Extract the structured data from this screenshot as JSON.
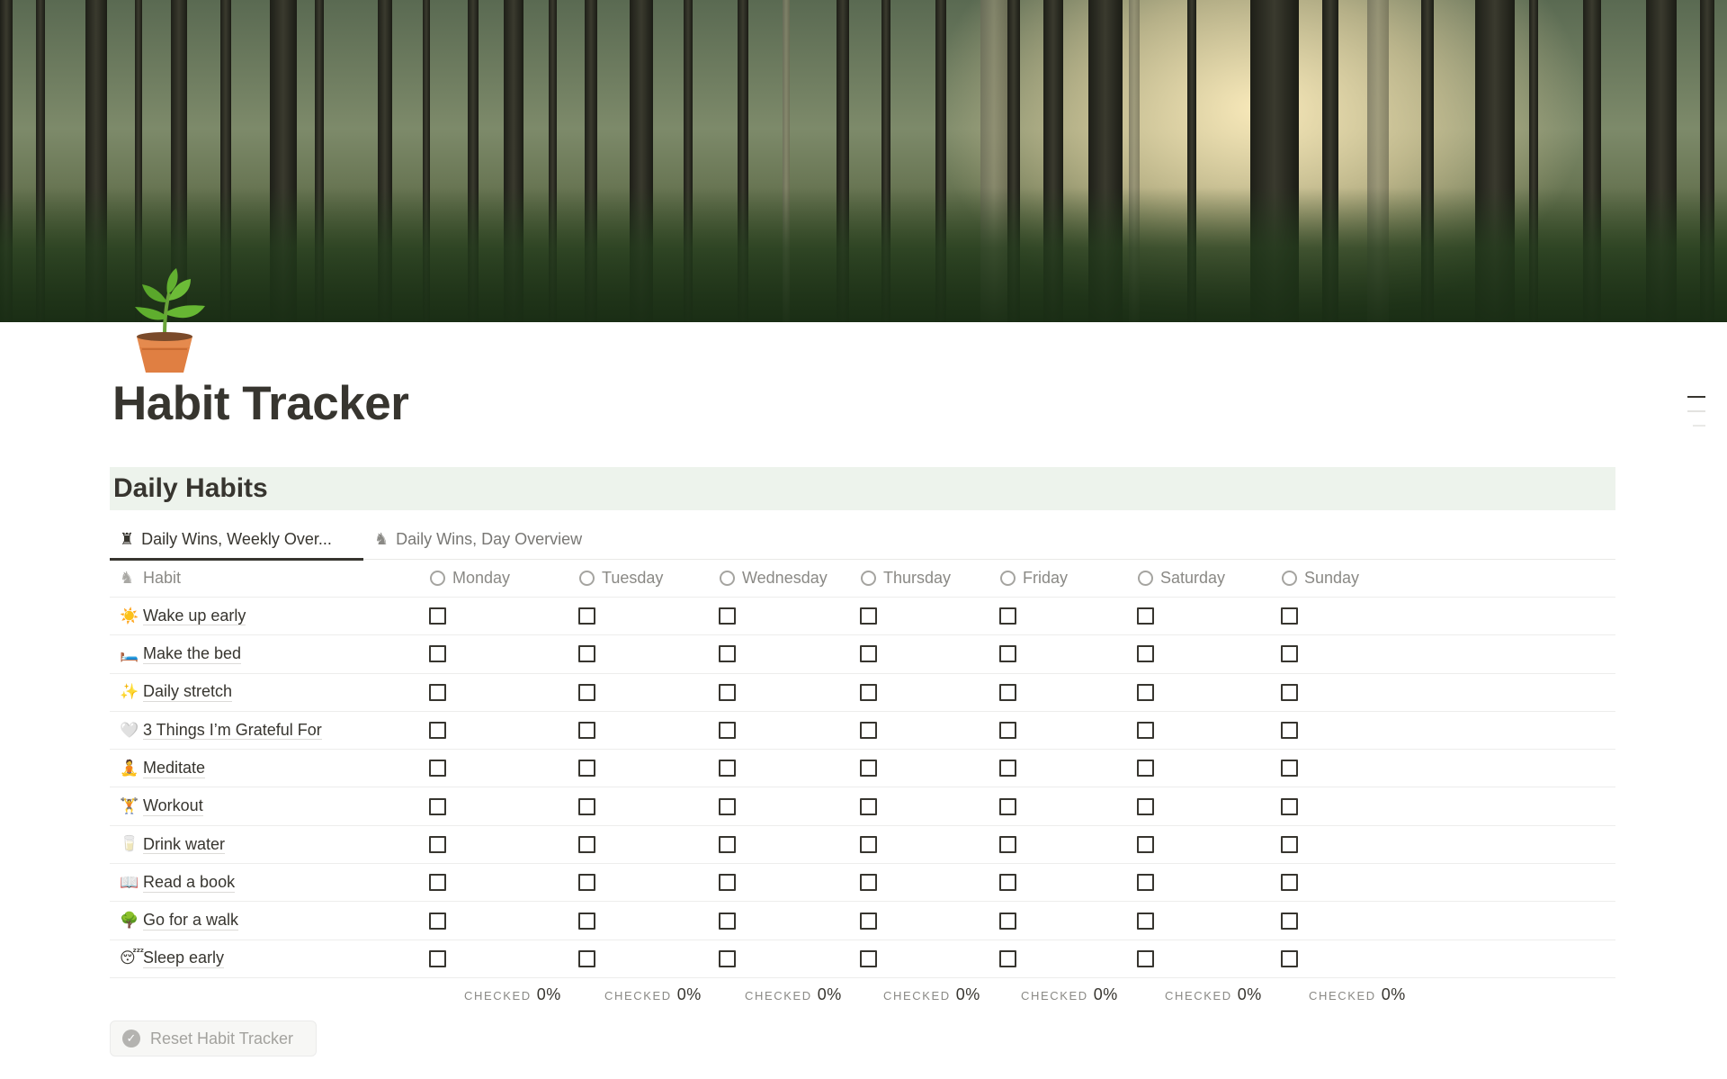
{
  "page": {
    "title": "Habit Tracker",
    "icon": "potted-plant"
  },
  "section": {
    "heading": "Daily Habits",
    "heading_bg": "#edf3ec"
  },
  "tabs": [
    {
      "label": "Daily Wins, Weekly Over...",
      "icon": "chess-rook-icon",
      "glyph": "♜",
      "active": true
    },
    {
      "label": "Daily Wins, Day Overview",
      "icon": "chess-knight-icon",
      "glyph": "♞",
      "active": false
    }
  ],
  "table": {
    "habit_header": {
      "label": "Habit",
      "icon": "chess-knight-icon",
      "glyph": "♞"
    },
    "days": [
      "Monday",
      "Tuesday",
      "Wednesday",
      "Thursday",
      "Friday",
      "Saturday",
      "Sunday"
    ],
    "rows": [
      {
        "emoji": "☀️",
        "icon": "sun-icon",
        "name": "Wake up early",
        "checks": [
          false,
          false,
          false,
          false,
          false,
          false,
          false
        ]
      },
      {
        "emoji": "🛏️",
        "icon": "bed-icon",
        "name": "Make the bed",
        "checks": [
          false,
          false,
          false,
          false,
          false,
          false,
          false
        ]
      },
      {
        "emoji": "✨",
        "icon": "sparkles-icon",
        "name": "Daily stretch",
        "checks": [
          false,
          false,
          false,
          false,
          false,
          false,
          false
        ]
      },
      {
        "emoji": "🤍",
        "icon": "white-heart-icon",
        "name": "3 Things I’m Grateful For",
        "checks": [
          false,
          false,
          false,
          false,
          false,
          false,
          false
        ]
      },
      {
        "emoji": "🧘",
        "icon": "meditation-icon",
        "name": "Meditate",
        "checks": [
          false,
          false,
          false,
          false,
          false,
          false,
          false
        ]
      },
      {
        "emoji": "🏋️",
        "icon": "weightlifter-icon",
        "name": "Workout",
        "checks": [
          false,
          false,
          false,
          false,
          false,
          false,
          false
        ]
      },
      {
        "emoji": "🥛",
        "icon": "glass-of-milk-icon",
        "name": "Drink water",
        "checks": [
          false,
          false,
          false,
          false,
          false,
          false,
          false
        ]
      },
      {
        "emoji": "📖",
        "icon": "open-book-icon",
        "name": "Read a book",
        "checks": [
          false,
          false,
          false,
          false,
          false,
          false,
          false
        ]
      },
      {
        "emoji": "🌳",
        "icon": "tree-icon",
        "name": "Go for a walk",
        "checks": [
          false,
          false,
          false,
          false,
          false,
          false,
          false
        ]
      },
      {
        "emoji": "😴",
        "icon": "sleeping-face-icon",
        "name": "Sleep early",
        "checks": [
          false,
          false,
          false,
          false,
          false,
          false,
          false
        ]
      }
    ],
    "summary": {
      "label": "CHECKED",
      "values": [
        "0%",
        "0%",
        "0%",
        "0%",
        "0%",
        "0%",
        "0%"
      ]
    }
  },
  "reset_button": {
    "label": "Reset Habit Tracker",
    "icon": "check-circle-icon"
  }
}
